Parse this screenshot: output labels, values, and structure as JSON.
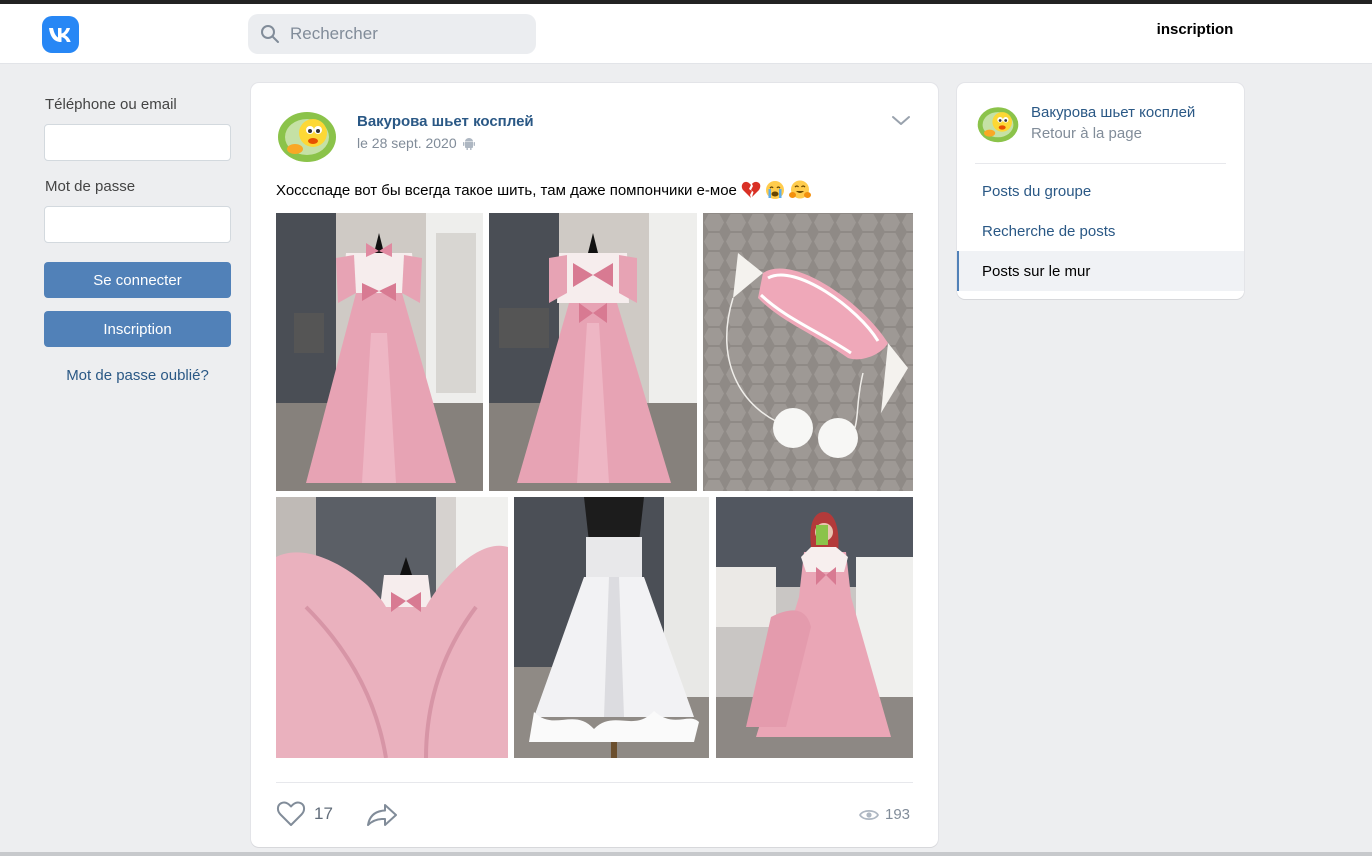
{
  "header": {
    "search_placeholder": "Rechercher",
    "signup_label": "inscription"
  },
  "login": {
    "phone_label": "Téléphone ou email",
    "password_label": "Mot de passe",
    "login_button": "Se connecter",
    "register_button": "Inscription",
    "forgot_link": "Mot de passe oublié?"
  },
  "post": {
    "author": "Вакурова шьет косплей",
    "date": "le 28 sept. 2020",
    "text": "Хоссспаде вот бы всегда такое шить, там даже помпончики е-мое",
    "emojis": [
      "broken-heart",
      "loudly-crying-face",
      "hugging-face"
    ],
    "likes": "17",
    "views": "193",
    "photos": [
      {
        "name": "photo-pink-dress-front"
      },
      {
        "name": "photo-pink-dress-back"
      },
      {
        "name": "photo-pink-mask-pompons"
      },
      {
        "name": "photo-pink-dress-spread"
      },
      {
        "name": "photo-white-petticoat"
      },
      {
        "name": "photo-girl-in-pink-dress"
      }
    ]
  },
  "sidebar": {
    "group_name": "Вакурова шьет косплей",
    "back_link": "Retour à la page",
    "items": [
      {
        "label": "Posts du groupe"
      },
      {
        "label": "Recherche de posts"
      },
      {
        "label": "Posts sur le mur"
      }
    ]
  },
  "colors": {
    "accent": "#5181b8",
    "link": "#2a5885",
    "background": "#edeef0",
    "vk_blue": "#2787f5"
  }
}
